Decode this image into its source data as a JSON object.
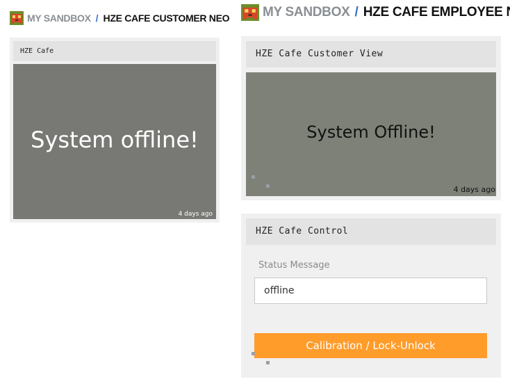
{
  "left_panel": {
    "breadcrumb": {
      "sandbox": "MY SANDBOX",
      "separator": "/",
      "page": "HZE CAFE CUSTOMER NEO"
    },
    "widget": {
      "title": "HZE Cafe",
      "screen_text": "System offline!",
      "timestamp": "4 days ago"
    }
  },
  "right_panel": {
    "breadcrumb": {
      "sandbox": "MY SANDBOX",
      "separator": "/",
      "page": "HZE CAFE EMPLOYEE NEO"
    },
    "view_widget": {
      "title": "HZE Cafe Customer View",
      "screen_text": "System Offline!",
      "timestamp": "4 days ago"
    },
    "control_widget": {
      "title": "HZE Cafe Control",
      "status_label": "Status Message",
      "status_value": "offline",
      "button_label": "Calibration / Lock-Unlock"
    }
  },
  "colors": {
    "accent_orange": "#ff9c2a",
    "screen_gray_left": "#787974",
    "screen_gray_right": "#7d8177",
    "separator_blue": "#3a6fc8"
  },
  "icons": {
    "logo": "pixel-invader-logo-icon"
  }
}
